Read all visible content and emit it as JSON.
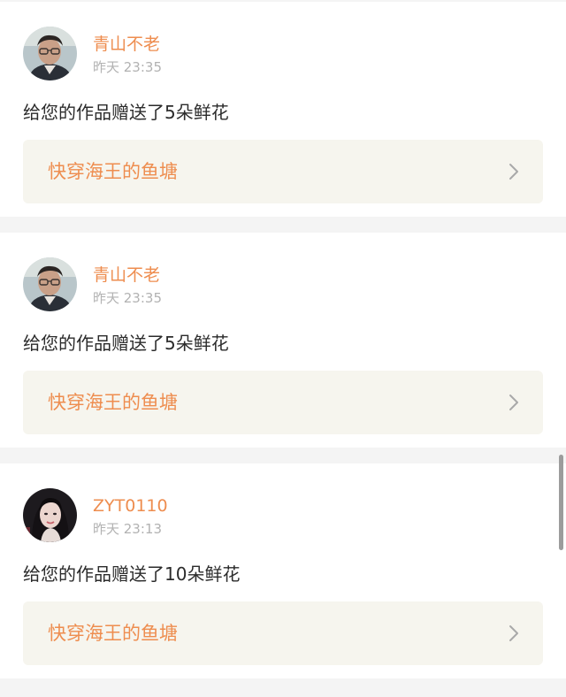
{
  "notifications": [
    {
      "avatar": "male-portrait-avatar",
      "username": "青山不老",
      "time": "昨天 23:35",
      "message": "给您的作品赠送了5朵鲜花",
      "work_title": "快穿海王的鱼塘",
      "chevron": "chevron-right-icon"
    },
    {
      "avatar": "male-portrait-avatar",
      "username": "青山不老",
      "time": "昨天 23:35",
      "message": "给您的作品赠送了5朵鲜花",
      "work_title": "快穿海王的鱼塘",
      "chevron": "chevron-right-icon"
    },
    {
      "avatar": "female-portrait-avatar",
      "username": "ZYT0110",
      "time": "昨天 23:13",
      "message": "给您的作品赠送了10朵鲜花",
      "work_title": "快穿海王的鱼塘",
      "chevron": "chevron-right-icon"
    }
  ],
  "colors": {
    "accent": "#ee8d4f",
    "link_card_bg": "#f6f5ee",
    "page_bg": "#f4f4f4"
  }
}
